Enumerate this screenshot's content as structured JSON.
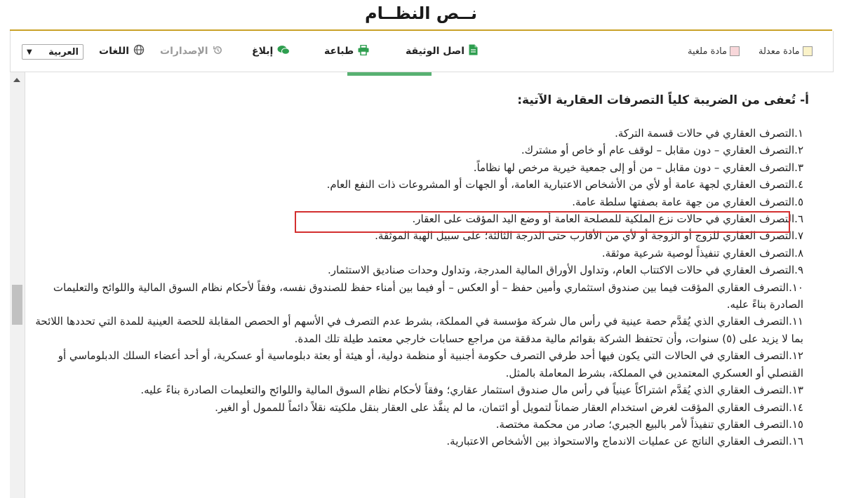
{
  "header": {
    "title": "نــص النظــام"
  },
  "toolbar": {
    "legend_modified": "مادة معدلة",
    "legend_cancelled": "مادة ملغية",
    "original_doc": "اصل الوثيقة",
    "print": "طباعة",
    "report": "إبلاغ",
    "versions": "الإصدارات",
    "languages": "اللغات",
    "language_selected": "العربية",
    "colors": {
      "modified": "#fbf3c9",
      "cancelled": "#f8d7da",
      "accent_green": "#2e9e4f"
    }
  },
  "content": {
    "heading": "أ- تُعفى من الضريبة كلياً التصرفات العقارية الآتية:",
    "items": [
      "١.التصرف العقاري في حالات قسمة التركة.",
      "٢.التصرف العقاري – دون مقابل – لوقف عام أو خاص أو مشترك.",
      "٣.التصرف العقاري – دون مقابل – من أو إلى جمعية خيرية مرخص لها نظاماً.",
      "٤.التصرف العقاري لجهة عامة أو لأي من الأشخاص الاعتبارية العامة، أو الجهات أو المشروعات ذات النفع العام.",
      "٥.التصرف العقاري من جهة عامة بصفتها سلطة عامة.",
      "٦.التصرف العقاري في حالات نزع الملكية للمصلحة العامة أو وضع اليد المؤقت على العقار.",
      "٧.التصرف العقاري للزوج أو الزوجة أو لأي من الأقارب حتى الدرجة الثالثة؛ على سبيل الهبة الموثقة.",
      "٨.التصرف العقاري تنفيذاً لوصية شرعية موثقة.",
      "٩.التصرف العقاري في حالات الاكتتاب العام، وتداول الأوراق المالية المدرجة، وتداول وحدات صناديق الاستثمار.",
      "١٠.التصرف العقاري المؤقت فيما بين صندوق استثماري وأمين حفظ – أو العكس – أو فيما بين أمناء حفظ للصندوق نفسه، وفقاً لأحكام نظام السوق المالية واللوائح والتعليمات الصادرة بناءً عليه.",
      "١١.التصرف العقاري الذي يُقدَّم حصة عينية في رأس مال شركة مؤسسة في المملكة، بشرط عدم التصرف في الأسهم أو الحصص المقابلة للحصة العينية للمدة التي تحددها اللائحة بما لا يزيد على (٥) سنوات، وأن تحتفظ الشركة بقوائم مالية مدققة من مراجع حسابات خارجي معتمد طيلة تلك المدة.",
      "١٢.التصرف العقاري في الحالات التي يكون فيها أحد طرفي التصرف حكومة أجنبية أو منظمة دولية، أو هيئة أو بعثة دبلوماسية أو عسكرية، أو أحد أعضاء السلك الدبلوماسي أو القنصلي أو العسكري المعتمدين في المملكة، بشرط المعاملة بالمثل.",
      "١٣.التصرف العقاري الذي يُقدَّم اشتراكاً عينياً في رأس مال صندوق استثمار عقاري؛ وفقاً لأحكام نظام السوق المالية واللوائح والتعليمات الصادرة بناءً عليه.",
      "١٤.التصرف العقاري المؤقت لغرض استخدام العقار ضماناً لتمويل أو ائتمان، ما لم ينفَّذ على العقار بنقل ملكيته نقلاً دائماً للممول أو الغير.",
      "١٥.التصرف العقاري تنفيذاً لأمر بالبيع الجبري؛ صادر من محكمة مختصة.",
      "١٦.التصرف العقاري الناتج عن عمليات الاندماج والاستحواذ بين الأشخاص الاعتبارية."
    ]
  }
}
